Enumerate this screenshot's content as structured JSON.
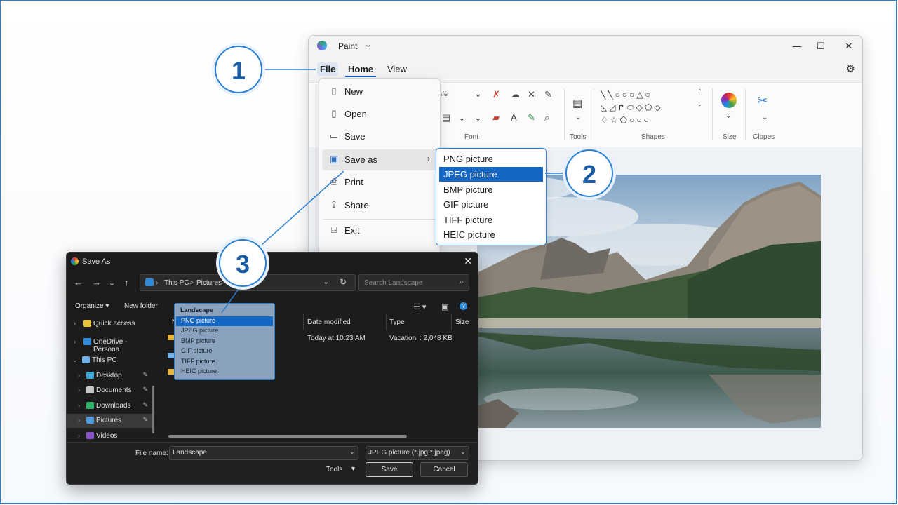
{
  "paint": {
    "app_title": "Paint",
    "menu": {
      "file": "File",
      "home": "Home",
      "view": "View"
    },
    "ribbon": {
      "font_label": "Font",
      "tools_label": "Tools",
      "shapes_label": "Shapes",
      "size_label": "Size",
      "clippings_label": "Clppes",
      "font_fragment": "sfé"
    }
  },
  "file_menu": {
    "items": [
      {
        "label": "New"
      },
      {
        "label": "Open"
      },
      {
        "label": "Save"
      },
      {
        "label": "Save as"
      },
      {
        "label": "Print"
      },
      {
        "label": "Share"
      },
      {
        "label": "Exit"
      }
    ]
  },
  "save_as_submenu": {
    "items": [
      "PNG picture",
      "JPEG picture",
      "BMP picture",
      "GIF picture",
      "TIFF picture",
      "HEIC picture"
    ],
    "selected": "JPEG picture"
  },
  "callouts": {
    "one": "1",
    "two": "2",
    "three": "3"
  },
  "dialog": {
    "title": "Save As",
    "address": {
      "pc": "This PC",
      "sep": ">",
      "folder": "Pictures",
      "sep2": ">"
    },
    "search_placeholder": "Search Landscape",
    "organize": "Organize",
    "new_folder": "New folder",
    "tree": [
      {
        "label": "Quick access"
      },
      {
        "label": "OneDrive - Persona"
      },
      {
        "label": "This PC"
      },
      {
        "label": "Desktop"
      },
      {
        "label": "Documents"
      },
      {
        "label": "Downloads"
      },
      {
        "label": "Pictures"
      },
      {
        "label": "Videos"
      }
    ],
    "columns": {
      "name": "N",
      "date": "Date modified",
      "type": "Type",
      "size": "Size"
    },
    "row": {
      "date": "Today at 10:23 AM",
      "type": "Vacation",
      "size": ": 2,048 KB"
    },
    "dropdown": {
      "header": "Landscape",
      "items": [
        "PNG picture",
        "JPEG picture",
        "BMP picture",
        "GIF picture",
        "TIFF picture",
        "HEIC picture"
      ],
      "selected": "PNG picture"
    },
    "file_name_label": "File name:",
    "file_name_value": "Landscape",
    "file_type_value": "JPEG picture (*.jpg;*.jpeg)",
    "tools": "Tools",
    "save": "Save",
    "cancel": "Cancel"
  },
  "colors": {
    "accent": "#2a7fd4",
    "selected": "#1666c4",
    "callout_text": "#1c5fa8"
  }
}
